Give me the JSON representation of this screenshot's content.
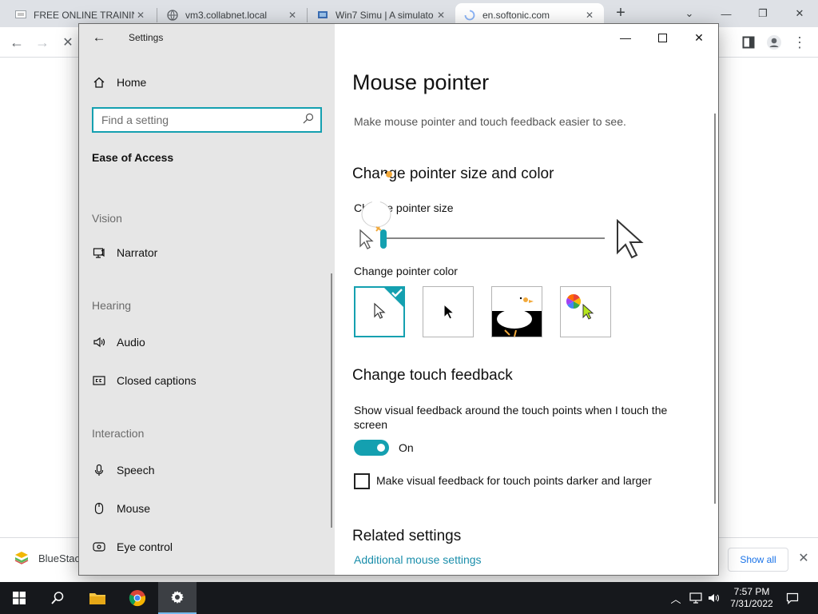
{
  "browser": {
    "tabs": [
      {
        "title": "FREE ONLINE TRAINING",
        "icon": "presentation-favicon"
      },
      {
        "title": "vm3.collabnet.local",
        "icon": "globe-icon"
      },
      {
        "title": "Win7 Simu | A simulato",
        "icon": "simulator-favicon"
      },
      {
        "title": "en.softonic.com",
        "icon": "loading-spinner-icon",
        "active": true
      }
    ],
    "download": {
      "filename": "BlueStac",
      "show_all": "Show all"
    }
  },
  "settings": {
    "app_title": "Settings",
    "sidebar": {
      "home": "Home",
      "search_placeholder": "Find a setting",
      "section": "Ease of Access",
      "groups": {
        "vision": "Vision",
        "hearing": "Hearing",
        "interaction": "Interaction"
      },
      "items": {
        "narrator": "Narrator",
        "audio": "Audio",
        "closed_captions": "Closed captions",
        "speech": "Speech",
        "mouse": "Mouse",
        "eye_control": "Eye control"
      }
    },
    "content": {
      "title": "Mouse pointer",
      "subtitle": "Make mouse pointer and touch feedback easier to see.",
      "pointer_section": "Change pointer size and color",
      "size_label": "Change pointer size",
      "size_value": 0.0,
      "color_label": "Change pointer color",
      "color_options": [
        "white",
        "black",
        "inverted",
        "custom"
      ],
      "selected_color": "white",
      "touch_section": "Change touch feedback",
      "touch_desc": "Show visual feedback around the touch points when I touch the screen",
      "toggle_state": "On",
      "checkbox_label": "Make visual feedback for touch points darker and larger",
      "checkbox_checked": false,
      "related_section": "Related settings",
      "related_link": "Additional mouse settings"
    }
  },
  "taskbar": {
    "time": "7:57 PM",
    "date": "7/31/2022"
  },
  "colors": {
    "accent": "#14a0b0",
    "link": "#1a8eab",
    "sidebar_bg": "#e6e6e6",
    "taskbar_bg": "#16181c"
  }
}
